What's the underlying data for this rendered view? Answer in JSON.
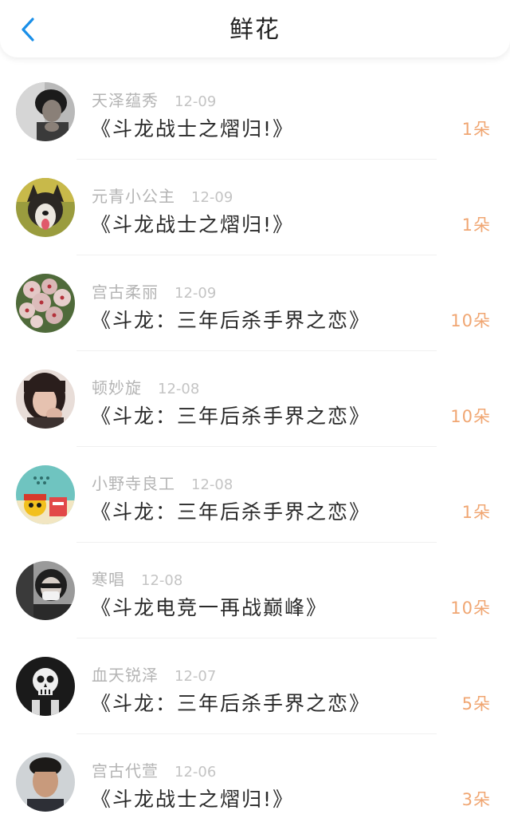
{
  "header": {
    "title": "鲜花",
    "back_icon": "chevron-left-icon",
    "accent_color": "#1a8fe8"
  },
  "colors": {
    "count": "#f0a672",
    "username": "#b4b4b4",
    "date": "#c4c4c4",
    "book": "#2a2a2a"
  },
  "rows": [
    {
      "username": "天泽蕴秀",
      "date": "12-09",
      "book": "《斗龙战士之熠归!》",
      "count": "1朵",
      "avatar": "person-portrait"
    },
    {
      "username": "元青小公主",
      "date": "12-09",
      "book": "《斗龙战士之熠归!》",
      "count": "1朵",
      "avatar": "dog"
    },
    {
      "username": "宫古柔丽",
      "date": "12-09",
      "book": "《斗龙：三年后杀手界之恋》",
      "count": "10朵",
      "avatar": "flowers"
    },
    {
      "username": "顿妙旋",
      "date": "12-08",
      "book": "《斗龙：三年后杀手界之恋》",
      "count": "10朵",
      "avatar": "girl-portrait"
    },
    {
      "username": "小野寺良工",
      "date": "12-08",
      "book": "《斗龙：三年后杀手界之恋》",
      "count": "1朵",
      "avatar": "cartoon"
    },
    {
      "username": "寒唱",
      "date": "12-08",
      "book": "《斗龙电竞一再战巅峰》",
      "count": "10朵",
      "avatar": "masked-person"
    },
    {
      "username": "血天锐泽",
      "date": "12-07",
      "book": "《斗龙：三年后杀手界之恋》",
      "count": "5朵",
      "avatar": "skull"
    },
    {
      "username": "宫古代萱",
      "date": "12-06",
      "book": "《斗龙战士之熠归!》",
      "count": "3朵",
      "avatar": "boy-portrait"
    }
  ]
}
